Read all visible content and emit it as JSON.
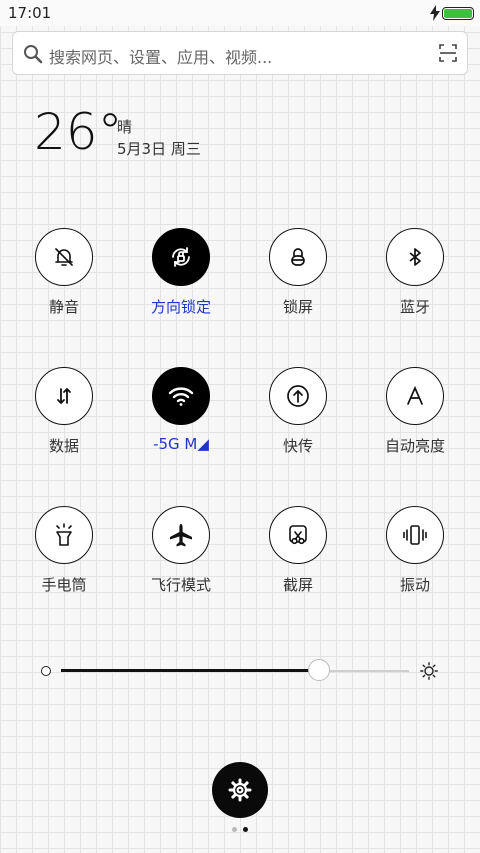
{
  "status_bar": {
    "time": "17:01",
    "battery_color": "#3fbf3f"
  },
  "search": {
    "placeholder": "搜索网页、设置、应用、视频..."
  },
  "weather": {
    "temperature": "26°",
    "condition": "晴",
    "date": "5月3日 周三"
  },
  "toggles": [
    {
      "label": "静音",
      "icon": "bell-off-icon",
      "active": false
    },
    {
      "label": "方向锁定",
      "icon": "rotation-lock-icon",
      "active": true
    },
    {
      "label": "锁屏",
      "icon": "lock-icon",
      "active": false
    },
    {
      "label": "蓝牙",
      "icon": "bluetooth-icon",
      "active": false
    },
    {
      "label": "数据",
      "icon": "data-arrows-icon",
      "active": false
    },
    {
      "label": "-5G    M◢",
      "icon": "wifi-icon",
      "active": true
    },
    {
      "label": "快传",
      "icon": "upload-icon",
      "active": false
    },
    {
      "label": "自动亮度",
      "icon": "auto-brightness-icon",
      "active": false
    },
    {
      "label": "手电筒",
      "icon": "flashlight-icon",
      "active": false
    },
    {
      "label": "飞行模式",
      "icon": "airplane-icon",
      "active": false
    },
    {
      "label": "截屏",
      "icon": "screenshot-icon",
      "active": false
    },
    {
      "label": "振动",
      "icon": "vibrate-icon",
      "active": false
    }
  ],
  "brightness": {
    "level": 0.74
  },
  "accent_color": "#2233cc",
  "pager": {
    "pages": 2,
    "current": 2
  }
}
